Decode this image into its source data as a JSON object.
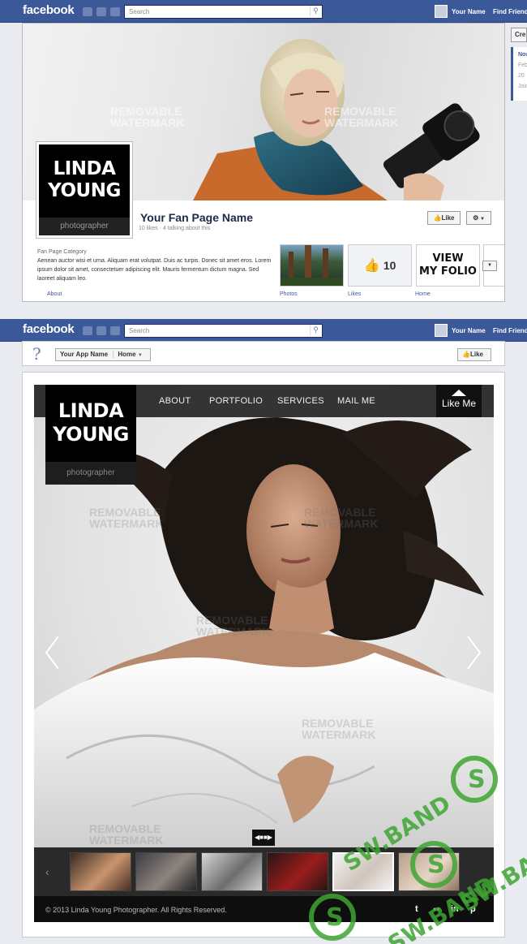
{
  "facebook_bar": {
    "logo": "facebook",
    "search_placeholder": "Search",
    "user_name": "Your Name",
    "find_friends": "Find Friends",
    "icons": [
      "friends-icon",
      "messages-icon",
      "notifications-icon",
      "search-icon"
    ]
  },
  "fan_page": {
    "watermark_line1": "REMOVABLE",
    "watermark_line2": "WATERMARK",
    "profile_name_line1": "LINDA",
    "profile_name_line2": "YOUNG",
    "profile_subtitle": "photographer",
    "page_name": "Your Fan Page Name",
    "likes_text": "10 likes · 4 talking about this",
    "like_button": "Like",
    "create_button": "Cre",
    "category": "Fan Page Category",
    "about_text": "Aenean auctor wisi et urna. Aliquam erat volutpat. Duis ac turpis. Donec sit amet eros. Lorem ipsum dolor sit amet, consectetuer adipiscing elit. Mauris fermentum dictum magna. Sed laoreet aliquam leo.",
    "likes_count": "10",
    "folio_line1": "VIEW",
    "folio_line2": "MY FOLIO",
    "tabs": [
      "About",
      "Photos",
      "Likes",
      "Home"
    ],
    "timeline": [
      "Now",
      "Feb",
      "20",
      "Join"
    ]
  },
  "app_page": {
    "help_glyph": "?",
    "app_name": "Your App Name",
    "home_tab": "Home",
    "like_button": "Like",
    "nav": [
      "ABOUT",
      "PORTFOLIO",
      "SERVICES",
      "MAIL ME"
    ],
    "like_me": "Like Me",
    "logo_line1": "LINDA",
    "logo_line2": "YOUNG",
    "logo_subtitle": "photographer",
    "watermark_line1": "REMOVABLE",
    "watermark_line2": "WATERMARK",
    "copyright": "© 2013 Linda Young Photographer. All Rights Reserved.",
    "social_icons": [
      "twitter-icon",
      "flickr-icon",
      "linkedin-icon",
      "pinterest-icon"
    ],
    "social_glyphs": [
      "t",
      "●●",
      "in",
      "p"
    ]
  },
  "stamp": {
    "text": "SW.BAND",
    "color": "#3fa532"
  }
}
